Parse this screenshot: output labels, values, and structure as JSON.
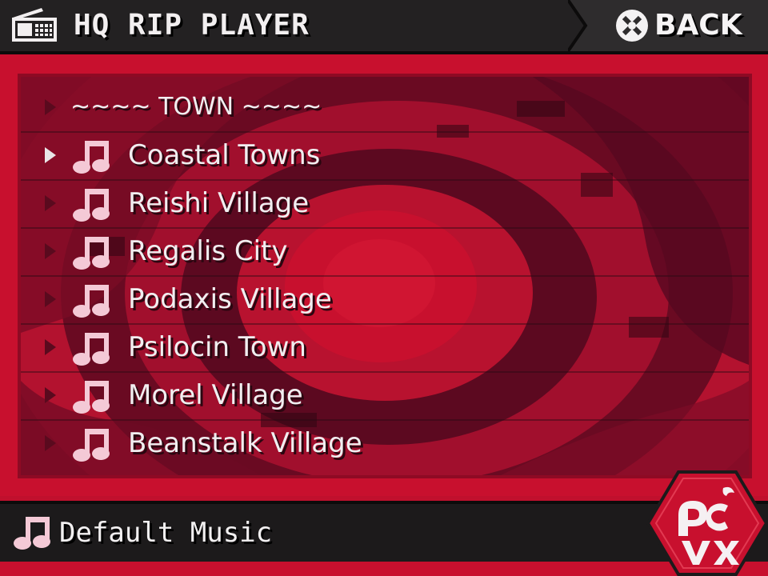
{
  "header": {
    "title": "HQ RIP PLAYER",
    "icon": "radio-icon",
    "back_label": "BACK",
    "back_icon": "x-button-icon"
  },
  "list": {
    "section_header": "~~~~ TOWN ~~~~",
    "selected_index": 0,
    "items": [
      {
        "label": "Coastal Towns"
      },
      {
        "label": "Reishi Village"
      },
      {
        "label": "Regalis City"
      },
      {
        "label": "Podaxis Village"
      },
      {
        "label": "Psilocin Town"
      },
      {
        "label": "Morel Village"
      },
      {
        "label": "Beanstalk Village"
      }
    ]
  },
  "footer": {
    "label": "Default Music",
    "icon": "music-note-icon"
  },
  "logo": {
    "name": "PICO VAX logo"
  },
  "colors": {
    "accent_red": "#c8102e",
    "dark_bar": "#232122",
    "text": "#f1eef0",
    "note_pink": "#f4c9d6"
  }
}
